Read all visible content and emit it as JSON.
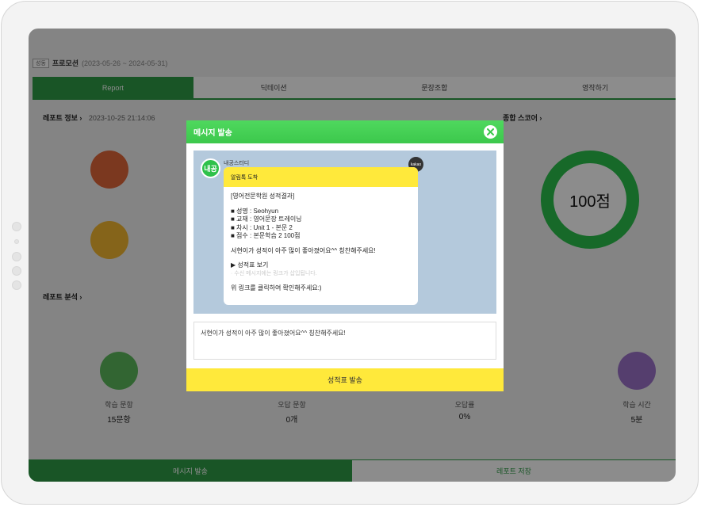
{
  "breadcrumb": {
    "tag": "성동",
    "title": "프로모션",
    "range": "(2023-05-26 ~ 2024-05-31)"
  },
  "tabs": [
    {
      "label": "Report",
      "active": true
    },
    {
      "label": "딕테이션",
      "active": false
    },
    {
      "label": "문장조합",
      "active": false
    },
    {
      "label": "영작하기",
      "active": false
    }
  ],
  "report_info": {
    "title": "레포트 정보",
    "timestamp": "2023-10-25 21:14:06"
  },
  "score": {
    "title": "종합 스코어",
    "value": "100점"
  },
  "report_analysis": {
    "title": "레포트 분석"
  },
  "stats": [
    {
      "label": "학습 문항",
      "value": "15문항"
    },
    {
      "label": "오답 문항",
      "value": "0개"
    },
    {
      "label": "오답률",
      "value": "0%"
    },
    {
      "label": "학습 시간",
      "value": "5분"
    }
  ],
  "bottom_bar": {
    "send_label": "메시지 발송",
    "save_label": "레포트 저장"
  },
  "modal": {
    "title": "메시지 발송",
    "sender_avatar": "내공",
    "sender_name": "내공스터디",
    "kakao_label": "kakao",
    "card_header": "알림톡 도착",
    "card_title": "[영어전문학원 성적결과]",
    "lines": [
      "■ 성명 : Seohyun",
      "■ 교재 : 영어문장 트레이닝",
      "■ 차시 : Unit 1 - 본문 2",
      "■ 점수 : 본문학습 2 100점"
    ],
    "praise": "서현이가 성적이 아주 많이 좋아졌어요^^ 칭찬해주세요!",
    "link_label": "▶ 성적표 보기",
    "link_note": "· 수신 메시지에는 링크가 삽입됩니다.",
    "footer": "위 링크를 클릭하여 확인해주세요:)",
    "message_input": "서현이가 성적이 아주 많이 좋아졌어요^^ 칭찬해주세요!",
    "send_button": "성적표 발송"
  },
  "colors": {
    "green": "#2e9b46",
    "modal_green": "#44cf54",
    "yellow": "#ffe93b"
  }
}
